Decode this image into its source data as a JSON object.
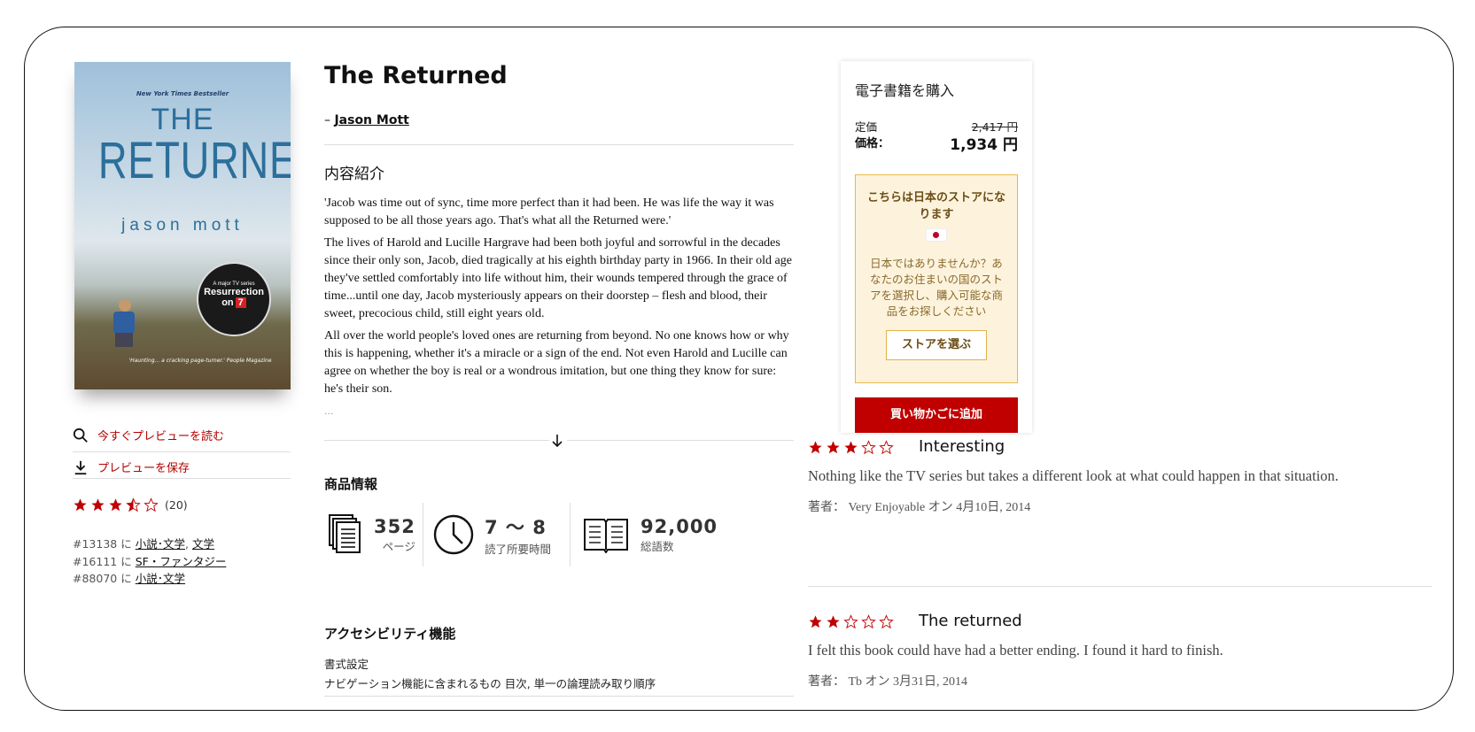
{
  "book": {
    "title": "The Returned",
    "author_prefix": "–",
    "author": "Jason Mott",
    "cover": {
      "badge_top": "New York Times Bestseller",
      "title_line1": "THE",
      "title_line2": "RETURNED",
      "author": "jason mott",
      "badge_small": "A major TV series",
      "badge_big": "Resurrection",
      "badge_on": "on",
      "badge_channel": "7",
      "quote": "'Haunting... a cracking page-turner.' People Magazine"
    }
  },
  "sidebar": {
    "preview_read": "今すぐプレビューを読む",
    "preview_save": "プレビューを保存",
    "rating_value": 3.5,
    "rating_count": "(20)",
    "rankings": [
      {
        "rank": "#13138",
        "in": "に",
        "links": [
          "小説･文学",
          "文学"
        ]
      },
      {
        "rank": "#16111",
        "in": "に",
        "links": [
          "SF・ファンタジー"
        ]
      },
      {
        "rank": "#88070",
        "in": "に",
        "links": [
          "小説･文学"
        ]
      }
    ]
  },
  "description": {
    "heading": "内容紹介",
    "paragraphs": [
      "'Jacob was time out of sync, time more perfect than it had been. He was life the way it was supposed to be all those years ago. That's what all the Returned were.'",
      "The lives of Harold and Lucille Hargrave had been both joyful and sorrowful in the decades since their only son, Jacob, died tragically at his eighth birthday party in 1966. In their old age they've settled comfortably into life without him, their wounds tempered through the grace of time...until one day, Jacob mysteriously appears on their doorstep – flesh and blood, their sweet, precocious child, still eight years old.",
      "All over the world people's loved ones are returning from beyond. No one knows how or why this is happening, whether it's a miracle or a sign of the end. Not even Harold and Lucille can agree on whether the boy is real or a wondrous imitation, but one thing they know for sure: he's their son."
    ],
    "ellipsis": "..."
  },
  "product_info": {
    "heading": "商品情報",
    "stats": [
      {
        "icon": "pages-icon",
        "value": "352",
        "label": "ページ"
      },
      {
        "icon": "clock-icon",
        "value": "7 ～ 8",
        "label": "読了所要時間"
      },
      {
        "icon": "book-open-icon",
        "value": "92,000",
        "label": "総語数"
      }
    ]
  },
  "accessibility": {
    "heading": "アクセシビリティ機能",
    "format_label": "書式設定",
    "nav_text": "ナビゲーション機能に含まれるもの 目次, 単一の論理読み取り順序"
  },
  "buy": {
    "heading": "電子書籍を購入",
    "list_price_label": "定価",
    "list_price": "2,417 円",
    "price_label": "価格：",
    "price": "1,934 円",
    "notice_title": "こちらは日本のストアになります",
    "notice_body": "日本ではありませんか？あなたのお住まいの国のストアを選択し、購入可能な商品をお探しください",
    "store_button": "ストアを選ぶ",
    "cart_button": "買い物かごに追加"
  },
  "reviews": [
    {
      "stars": 3,
      "title": "Interesting",
      "body": "Nothing like the TV series but takes a different look at what could happen in that situation.",
      "meta": "著者： Very Enjoyable オン 4月10日, 2014"
    },
    {
      "stars": 2,
      "title": "The returned",
      "body": "I felt this book could have had a better ending. I found it hard to finish.",
      "meta": "著者： Tb オン 3月31日, 2014"
    }
  ],
  "colors": {
    "accent": "#b30000",
    "star": "#c00000",
    "notice_bg": "#fdf3dd",
    "notice_border": "#e8b94a"
  }
}
